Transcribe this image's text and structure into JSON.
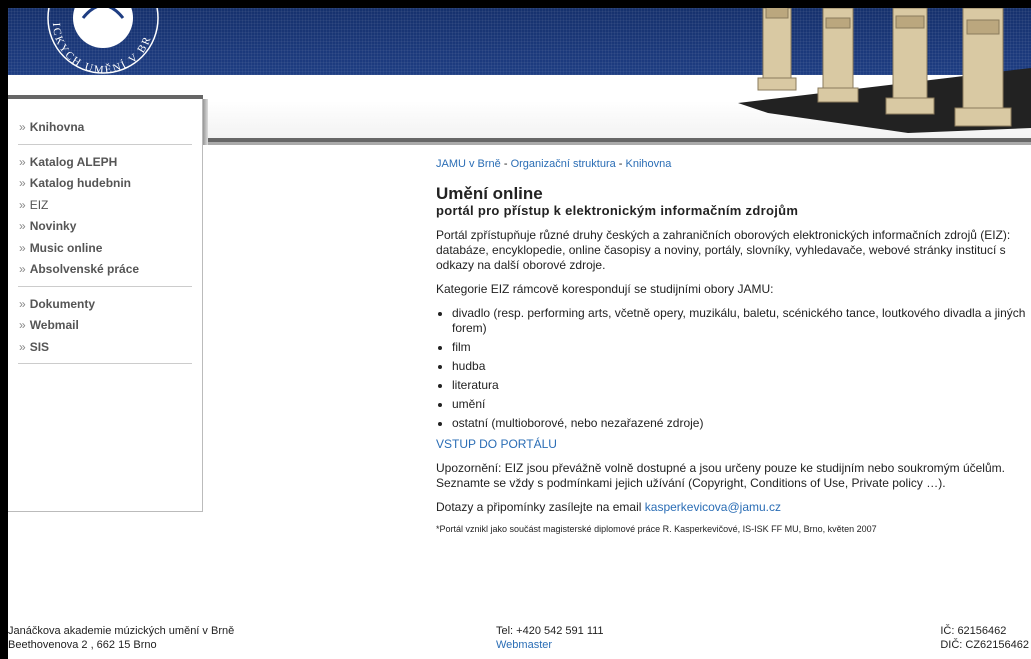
{
  "header": {
    "logo_text": "ICKYCH UMĚNÍ V BR"
  },
  "sidebar": {
    "groups": [
      [
        "Knihovna"
      ],
      [
        "Katalog ALEPH",
        "Katalog hudebnin",
        "EIZ",
        "Novinky",
        "Music online",
        "Absolvenské práce"
      ],
      [
        "Dokumenty",
        "Webmail",
        "SIS"
      ]
    ],
    "bold": [
      true,
      true,
      false,
      true,
      true,
      true,
      true,
      true,
      true,
      true
    ]
  },
  "breadcrumb": {
    "item1": "JAMU v Brně",
    "sep": " - ",
    "item2": "Organizační struktura",
    "item3": "Knihovna"
  },
  "main": {
    "title": "Umění online",
    "subtitle": "portál pro přístup k elektronickým informačním zdrojům",
    "intro": "Portál zpřístupňuje různé druhy českých a zahraničních oborových elektronických informačních zdrojů (EIZ): databáze, encyklopedie, online časopisy a noviny, portály, slovníky, vyhledavače, webové stránky institucí s odkazy na další oborové zdroje.",
    "categories_intro": "Kategorie EIZ rámcově korespondují se studijními obory JAMU:",
    "categories": [
      "divadlo (resp. performing arts, včetně opery, muzikálu, baletu, scénického tance, loutkového divadla a jiných forem)",
      "film",
      "hudba",
      "literatura",
      "umění",
      "ostatní (multioborové, nebo nezařazené zdroje)"
    ],
    "portal_link": "VSTUP DO PORTÁLU",
    "warning": "Upozornění: EIZ jsou převážně volně dostupné a jsou určeny pouze ke studijním nebo soukromým účelům. Seznamte se vždy s podmínkami jejich užívání (Copyright, Conditions of Use, Private policy …).",
    "contact_text": "Dotazy a připomínky zasílejte na email ",
    "contact_email": "kasperkevicova@jamu.cz",
    "footnote": "*Portál vznikl jako součást magisterské diplomové práce R. Kasperkevičové, IS-ISK FF MU, Brno, květen 2007"
  },
  "footer": {
    "org": "Janáčkova akademie múzických umění v Brně",
    "address": "Beethovenova 2 , 662 15  Brno",
    "tel": "Tel: +420 542 591 111",
    "webmaster": "Webmaster",
    "ic": "IČ: 62156462",
    "dic": "DIČ: CZ62156462"
  }
}
